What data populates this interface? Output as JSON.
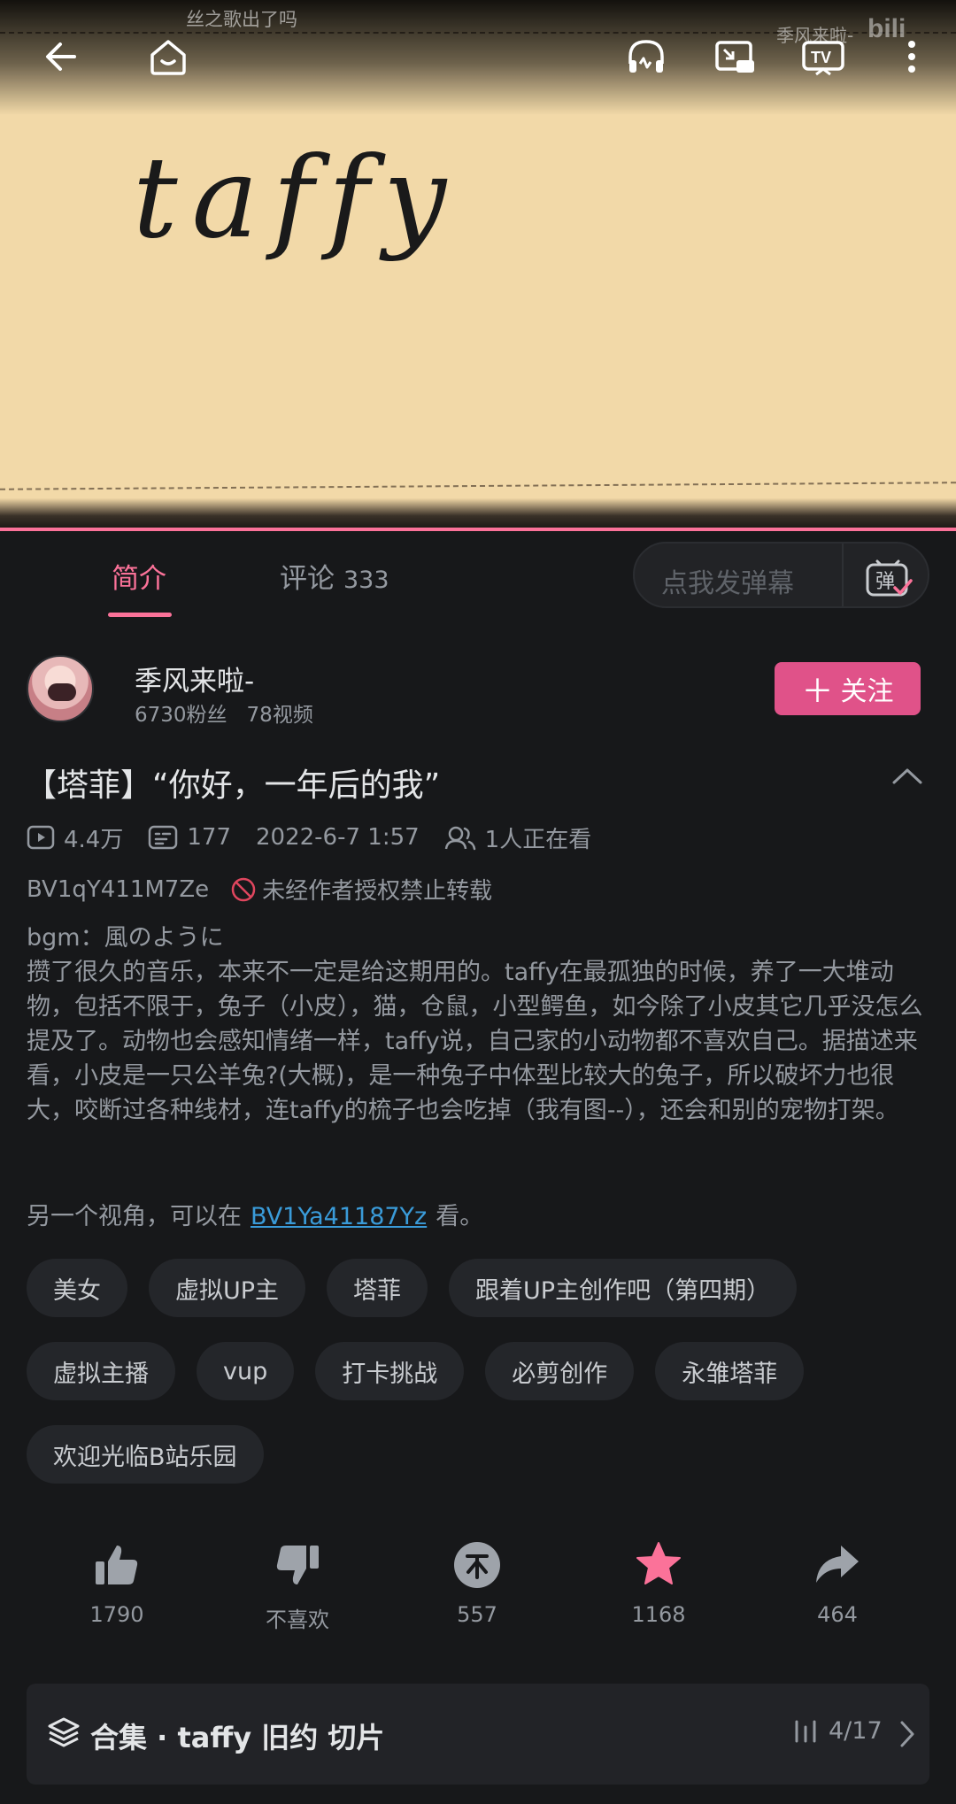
{
  "player": {
    "video_art_text": "taffy",
    "floating_danmaku": "丝之歌出了吗",
    "watermark_user": "季风来啦-",
    "watermark_logo": "bilibili",
    "icons": [
      "back-icon",
      "home-icon",
      "listen-icon",
      "pip-icon",
      "tv-cast-icon",
      "more-icon"
    ]
  },
  "tabs": {
    "intro_label": "简介",
    "comments_label": "评论",
    "comments_count": "333"
  },
  "danmaku": {
    "placeholder": "点我发弹幕",
    "toggle_glyph": "弹"
  },
  "uploader": {
    "name": "季风来啦-",
    "fans": "6730粉丝",
    "videos": "78视频",
    "follow_label": "关注"
  },
  "video": {
    "title": "【塔菲】“你好，一年后的我”",
    "views": "4.4万",
    "danmaku_count": "177",
    "date": "2022-6-7 1:57",
    "watching": "1人正在看",
    "bvid": "BV1qY411M7Ze",
    "copyright": "未经作者授权禁止转载",
    "description": "bgm：風のように\n攒了很久的音乐，本来不一定是给这期用的。taffy在最孤独的时候，养了一大堆动物，包括不限于，兔子（小皮），猫，仓鼠，小型鳄鱼，如今除了小皮其它几乎没怎么提及了。动物也会感知情绪一样，taffy说，自己家的小动物都不喜欢自己。据描述来看，小皮是一只公羊兔?(大概)，是一种兔子中体型比较大的兔子，所以破坏力也很大，咬断过各种线材，连taffy的梳子也会吃掉（我有图--），还会和别的宠物打架。",
    "link_prefix": "另一个视角，可以在",
    "link_text": "BV1Ya41187Yz",
    "link_suffix": "看。"
  },
  "tags": [
    "美女",
    "虚拟UP主",
    "塔菲",
    "跟着UP主创作吧（第四期）",
    "虚拟主播",
    "vup",
    "打卡挑战",
    "必剪创作",
    "永雏塔菲",
    "欢迎光临B站乐园"
  ],
  "actions": {
    "like": "1790",
    "dislike": "不喜欢",
    "coin": "557",
    "favorite": "1168",
    "share": "464"
  },
  "collection": {
    "title": "合集 · taffy 旧约 切片",
    "progress": "4/17"
  },
  "colors": {
    "accent": "#fb7299",
    "follow": "#e05289",
    "link": "#3a9bd9",
    "background": "#17181a"
  }
}
